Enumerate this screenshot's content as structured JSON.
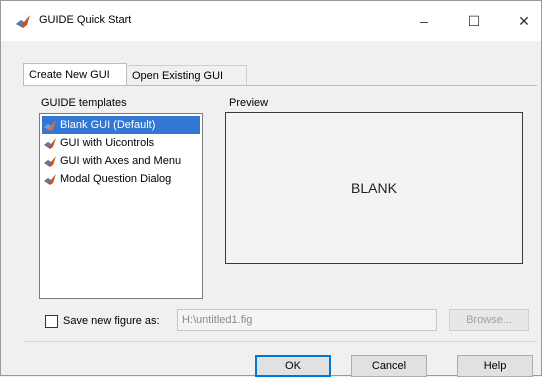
{
  "window": {
    "title": "GUIDE Quick Start",
    "minimize_symbol": "–",
    "maximize_symbol": "☐",
    "close_symbol": "✕"
  },
  "tabs": [
    {
      "label": "Create New GUI",
      "active": true
    },
    {
      "label": "Open Existing GUI",
      "active": false
    }
  ],
  "templates": {
    "label": "GUIDE templates",
    "items": [
      {
        "label": "Blank GUI (Default)",
        "selected": true,
        "icon": "matlab-icon"
      },
      {
        "label": "GUI with Uicontrols",
        "selected": false,
        "icon": "matlab-icon"
      },
      {
        "label": "GUI with Axes and Menu",
        "selected": false,
        "icon": "matlab-icon"
      },
      {
        "label": "Modal Question Dialog",
        "selected": false,
        "icon": "matlab-icon"
      }
    ]
  },
  "preview": {
    "label": "Preview",
    "text": "BLANK"
  },
  "save": {
    "label": "Save new figure as:",
    "checked": false,
    "path_value": "H:\\untitled1.fig",
    "browse_label": "Browse..."
  },
  "buttons": {
    "ok": "OK",
    "cancel": "Cancel",
    "help": "Help"
  },
  "colors": {
    "selection": "#3277d4",
    "window_bg": "#f0f0f0",
    "default_button_border": "#0078d7"
  }
}
